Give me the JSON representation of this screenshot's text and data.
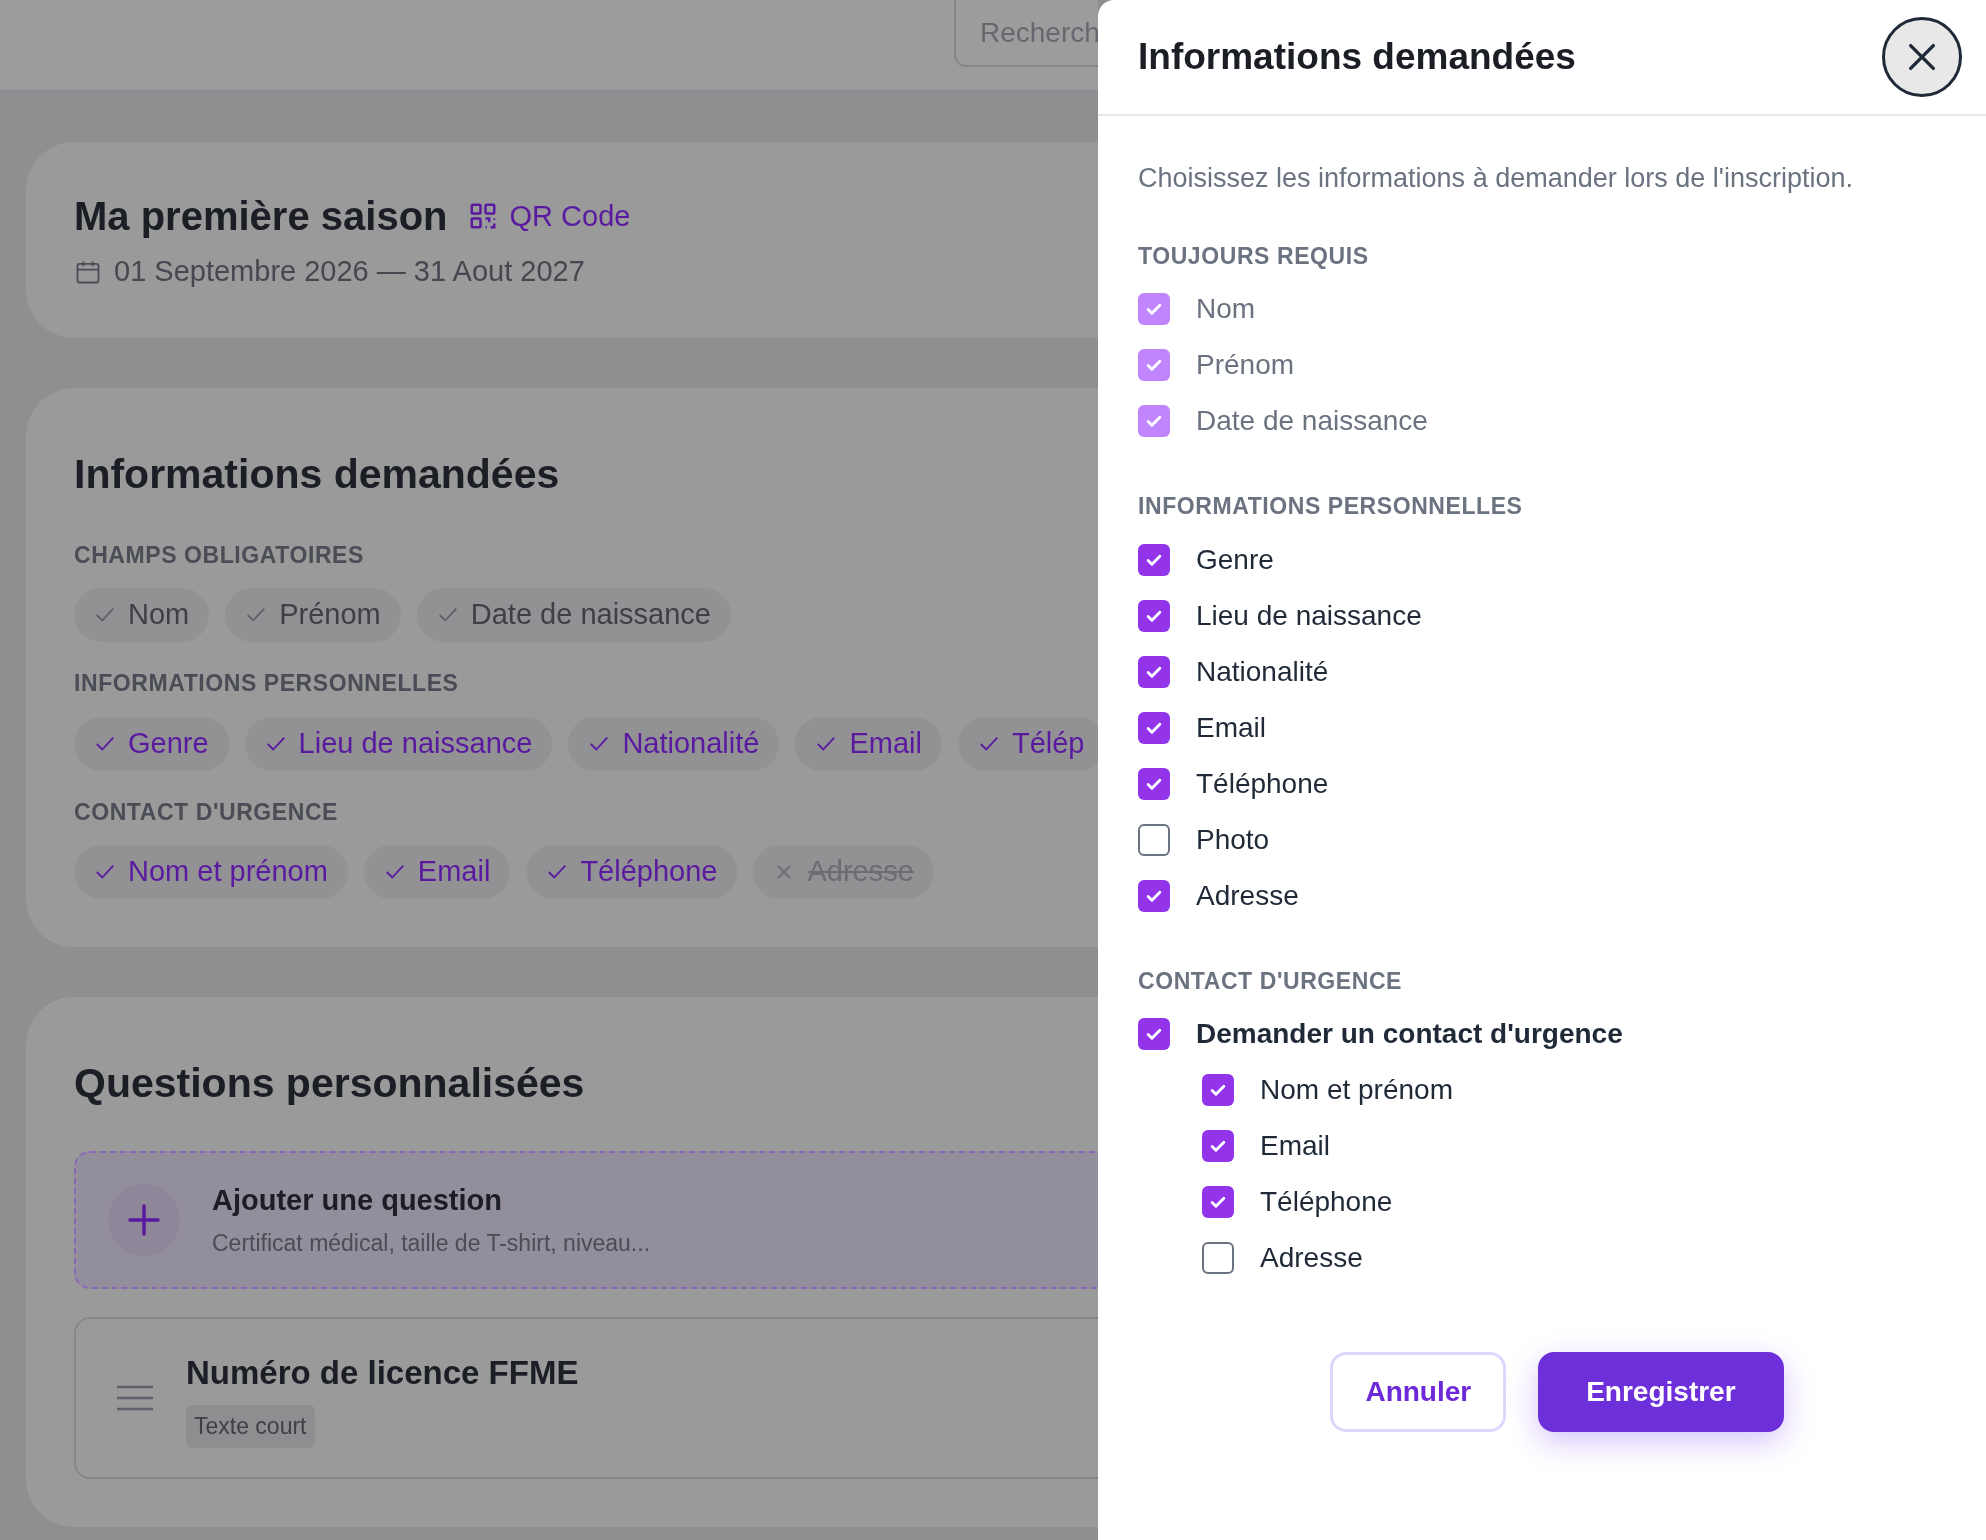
{
  "search": {
    "placeholder": "Recherch"
  },
  "season": {
    "title": "Ma première saison",
    "qr_label": "QR Code",
    "dates": "01 Septembre 2026 — 31 Aout 2027"
  },
  "info_card": {
    "title": "Informations demandées",
    "groups": [
      {
        "label": "CHAMPS OBLIGATOIRES",
        "chips": [
          {
            "label": "Nom",
            "enabled": true,
            "locked": true
          },
          {
            "label": "Prénom",
            "enabled": true,
            "locked": true
          },
          {
            "label": "Date de naissance",
            "enabled": true,
            "locked": true
          }
        ]
      },
      {
        "label": "INFORMATIONS PERSONNELLES",
        "chips": [
          {
            "label": "Genre",
            "enabled": true,
            "locked": false
          },
          {
            "label": "Lieu de naissance",
            "enabled": true,
            "locked": false
          },
          {
            "label": "Nationalité",
            "enabled": true,
            "locked": false
          },
          {
            "label": "Email",
            "enabled": true,
            "locked": false
          },
          {
            "label": "Télép",
            "enabled": true,
            "locked": false
          }
        ]
      },
      {
        "label": "CONTACT D'URGENCE",
        "chips": [
          {
            "label": "Nom et prénom",
            "enabled": true,
            "locked": false
          },
          {
            "label": "Email",
            "enabled": true,
            "locked": false
          },
          {
            "label": "Téléphone",
            "enabled": true,
            "locked": false
          },
          {
            "label": "Adresse",
            "enabled": false
          }
        ]
      }
    ]
  },
  "questions_card": {
    "title": "Questions personnalisées",
    "add": {
      "title": "Ajouter une question",
      "hint": "Certificat médical, taille de T-shirt, niveau..."
    },
    "questions": [
      {
        "title": "Numéro de licence FFME",
        "type_label": "Texte court"
      }
    ]
  },
  "panel": {
    "title": "Informations demandées",
    "description": "Choisissez les informations à demander lors de l'inscription.",
    "sections": [
      {
        "label": "TOUJOURS REQUIS",
        "items": [
          {
            "label": "Nom",
            "checked": true,
            "disabled": true
          },
          {
            "label": "Prénom",
            "checked": true,
            "disabled": true
          },
          {
            "label": "Date de naissance",
            "checked": true,
            "disabled": true
          }
        ]
      },
      {
        "label": "INFORMATIONS PERSONNELLES",
        "items": [
          {
            "label": "Genre",
            "checked": true,
            "disabled": false
          },
          {
            "label": "Lieu de naissance",
            "checked": true,
            "disabled": false
          },
          {
            "label": "Nationalité",
            "checked": true,
            "disabled": false
          },
          {
            "label": "Email",
            "checked": true,
            "disabled": false
          },
          {
            "label": "Téléphone",
            "checked": true,
            "disabled": false
          },
          {
            "label": "Photo",
            "checked": false,
            "disabled": false
          },
          {
            "label": "Adresse",
            "checked": true,
            "disabled": false
          }
        ]
      },
      {
        "label": "CONTACT D'URGENCE",
        "items": [
          {
            "label": "Demander un contact d'urgence",
            "checked": true,
            "disabled": false,
            "children": [
              {
                "label": "Nom et prénom",
                "checked": true,
                "disabled": false
              },
              {
                "label": "Email",
                "checked": true,
                "disabled": false
              },
              {
                "label": "Téléphone",
                "checked": true,
                "disabled": false
              },
              {
                "label": "Adresse",
                "checked": false,
                "disabled": false
              }
            ]
          }
        ]
      }
    ]
  },
  "buttons": {
    "cancel": "Annuler",
    "save": "Enregistrer"
  }
}
